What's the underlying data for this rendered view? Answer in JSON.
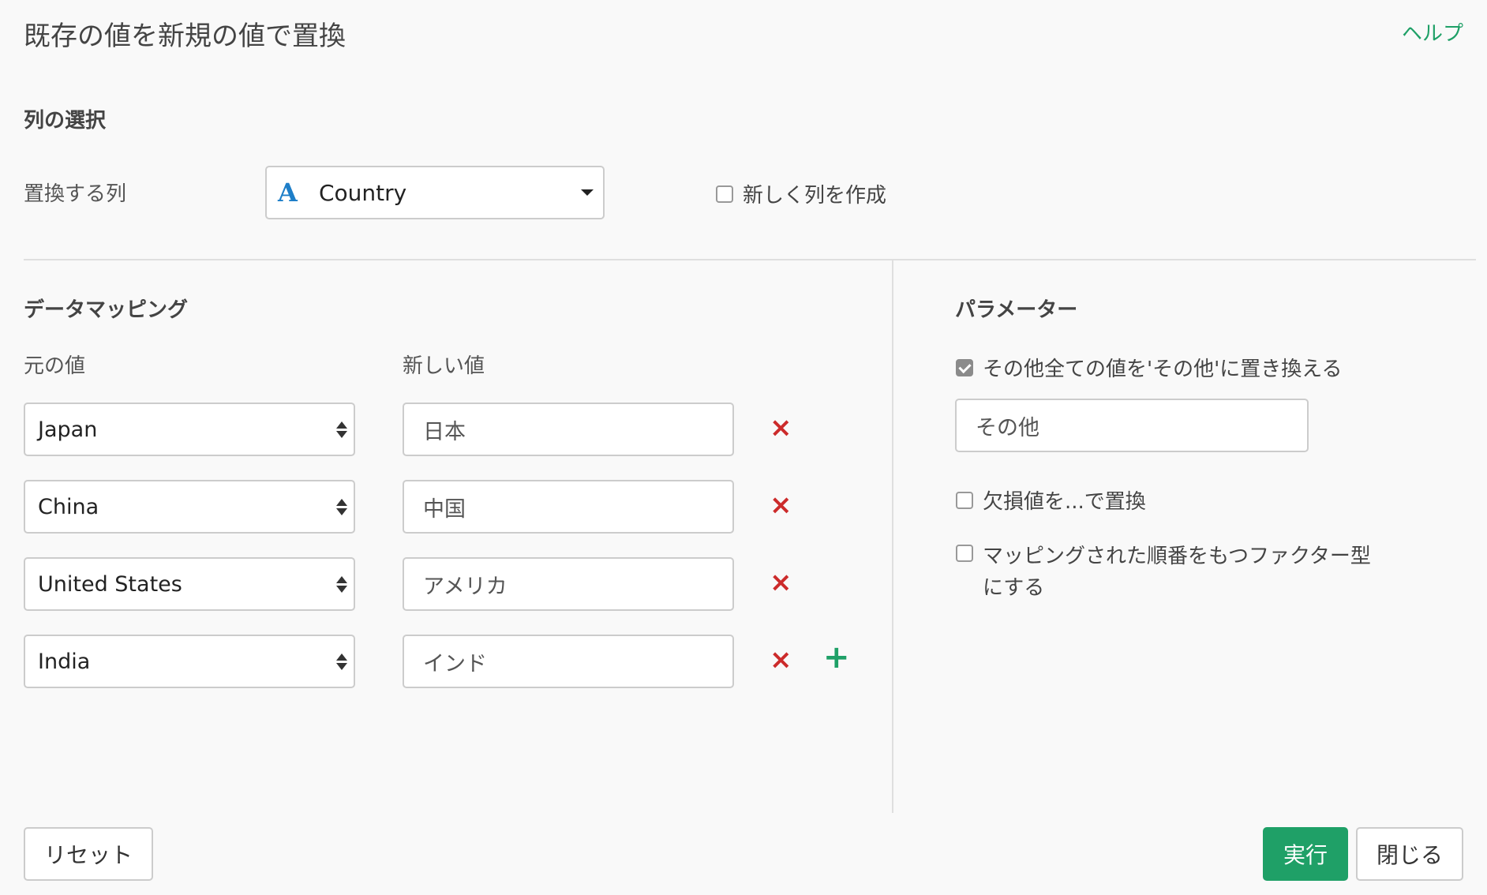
{
  "dialog": {
    "title": "既存の値を新規の値で置換",
    "help_label": "ヘルプ"
  },
  "column_selection": {
    "section_title": "列の選択",
    "label": "置換する列",
    "selected_column": "Country",
    "column_type_icon": "A",
    "new_column_checkbox": {
      "label": "新しく列を作成",
      "checked": false
    }
  },
  "data_mapping": {
    "section_title": "データマッピング",
    "col_original_header": "元の値",
    "col_new_header": "新しい値",
    "rows": [
      {
        "original": "Japan",
        "new": "日本"
      },
      {
        "original": "China",
        "new": "中国"
      },
      {
        "original": "United States",
        "new": "アメリカ"
      },
      {
        "original": "India",
        "new": "インド"
      }
    ],
    "remove_icon": "×",
    "add_icon": "+"
  },
  "parameters": {
    "section_title": "パラメーター",
    "replace_others": {
      "label": "その他全ての値を'その他'に置き換える",
      "checked": true
    },
    "others_value": "その他",
    "replace_missing": {
      "label": "欠損値を...で置換",
      "checked": false
    },
    "as_factor": {
      "label_line1": "マッピングされた順番をもつファクター型",
      "label_line2": "にする",
      "checked": false
    }
  },
  "footer": {
    "reset_label": "リセット",
    "run_label": "実行",
    "close_label": "閉じる"
  },
  "colors": {
    "accent": "#1fa067",
    "danger": "#cc2b2b",
    "type_icon": "#1d7ec8"
  }
}
